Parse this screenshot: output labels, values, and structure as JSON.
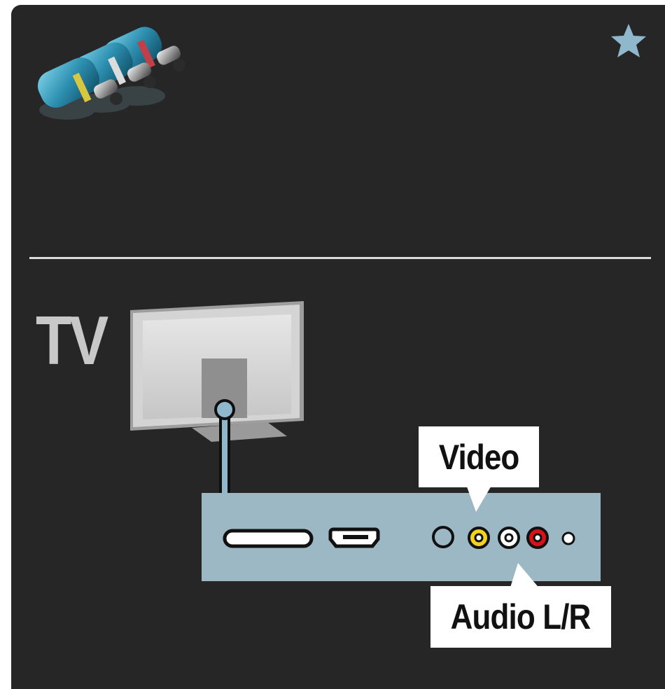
{
  "device_label": "TV",
  "callouts": {
    "video": "Video",
    "audio": "Audio L/R"
  },
  "icons": {
    "cable": "rca-cable-icon",
    "favorite": "star-icon",
    "television": "tv-back-icon",
    "connector_panel": "connector-panel-icon"
  },
  "colors": {
    "background": "#262626",
    "panel": "#9db8c5",
    "video_jack": "#f2d21b",
    "audio_left_jack": "#ffffff",
    "audio_right_jack": "#d9121a",
    "star": "#8fb8cc"
  }
}
